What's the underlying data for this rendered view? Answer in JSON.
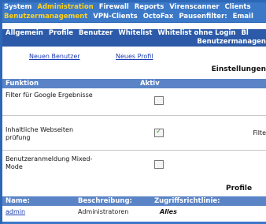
{
  "topnav": {
    "row1": [
      "System",
      "Administration",
      "Firewall",
      "Reports",
      "Virenscanner",
      "Clients"
    ],
    "row1_active": "Administration",
    "row2": [
      "Benutzermanagement",
      "VPN-Clients",
      "OctoFax",
      "Pausenfilter:",
      "Email"
    ]
  },
  "subnav": {
    "items": [
      "Allgemein",
      "Profile",
      "Benutzer",
      "Whitelist",
      "Whitelist ohne Login",
      "Bl"
    ],
    "title": "Benutzermanagen"
  },
  "actions": {
    "new_user": "Neuen Benutzer",
    "new_profile": "Neues Profil"
  },
  "settings": {
    "heading": "Einstellungen",
    "col_function": "Funktion",
    "col_active": "Aktiv",
    "rows": [
      {
        "label": "Filter für Google Ergebnisse",
        "checked": false
      },
      {
        "label": "Inhaltliche Webseiten prüfung",
        "checked": true,
        "side": "Filte"
      },
      {
        "label": "Benutzeranmeldung Mixed-Mode",
        "checked": false
      }
    ]
  },
  "profiles": {
    "heading": "Profile",
    "col_name": "Name:",
    "col_desc": "Beschreibung:",
    "col_access": "Zugriffsrichtlinie:",
    "rows": [
      {
        "name": "admin",
        "description": "Administratoren",
        "access": "Alles"
      }
    ]
  }
}
